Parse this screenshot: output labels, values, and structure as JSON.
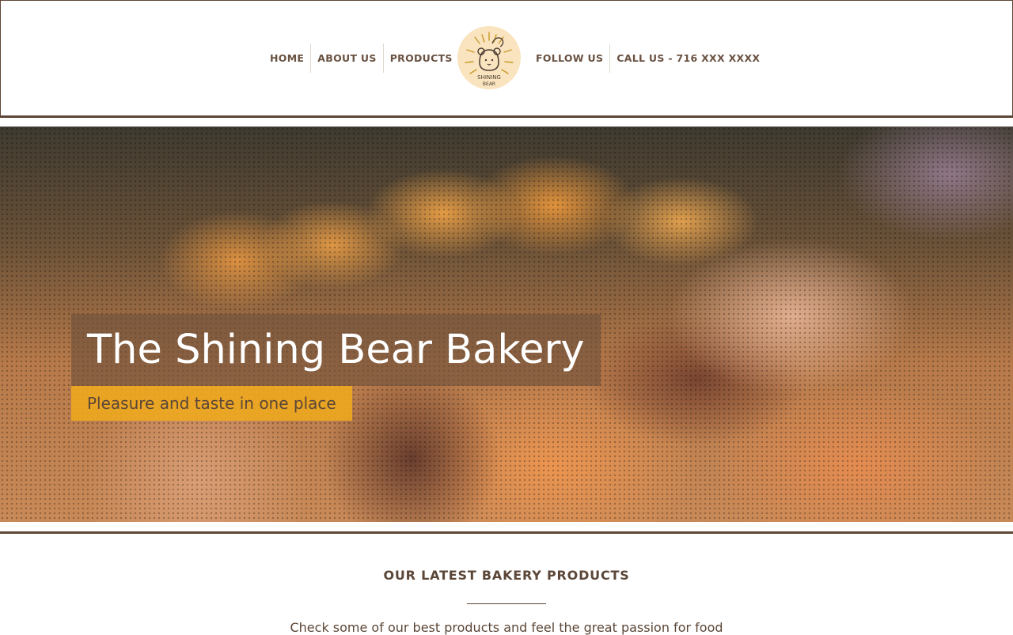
{
  "nav": {
    "left": [
      "HOME",
      "ABOUT US",
      "PRODUCTS"
    ],
    "right": [
      "FOLLOW US",
      "CALL US - 716 XXX XXXX"
    ]
  },
  "logo": {
    "text_line1": "SHINING",
    "text_line2": "BEAR"
  },
  "hero": {
    "title": "The Shining Bear Bakery",
    "subtitle": "Pleasure and taste in one place"
  },
  "products": {
    "heading": "OUR LATEST BAKERY PRODUCTS",
    "description": "Check some of our best products and feel the great passion for food"
  },
  "colors": {
    "brand_brown": "#5b4637",
    "accent_yellow": "#f0aa1e",
    "logo_bg": "#f9e4bf"
  }
}
